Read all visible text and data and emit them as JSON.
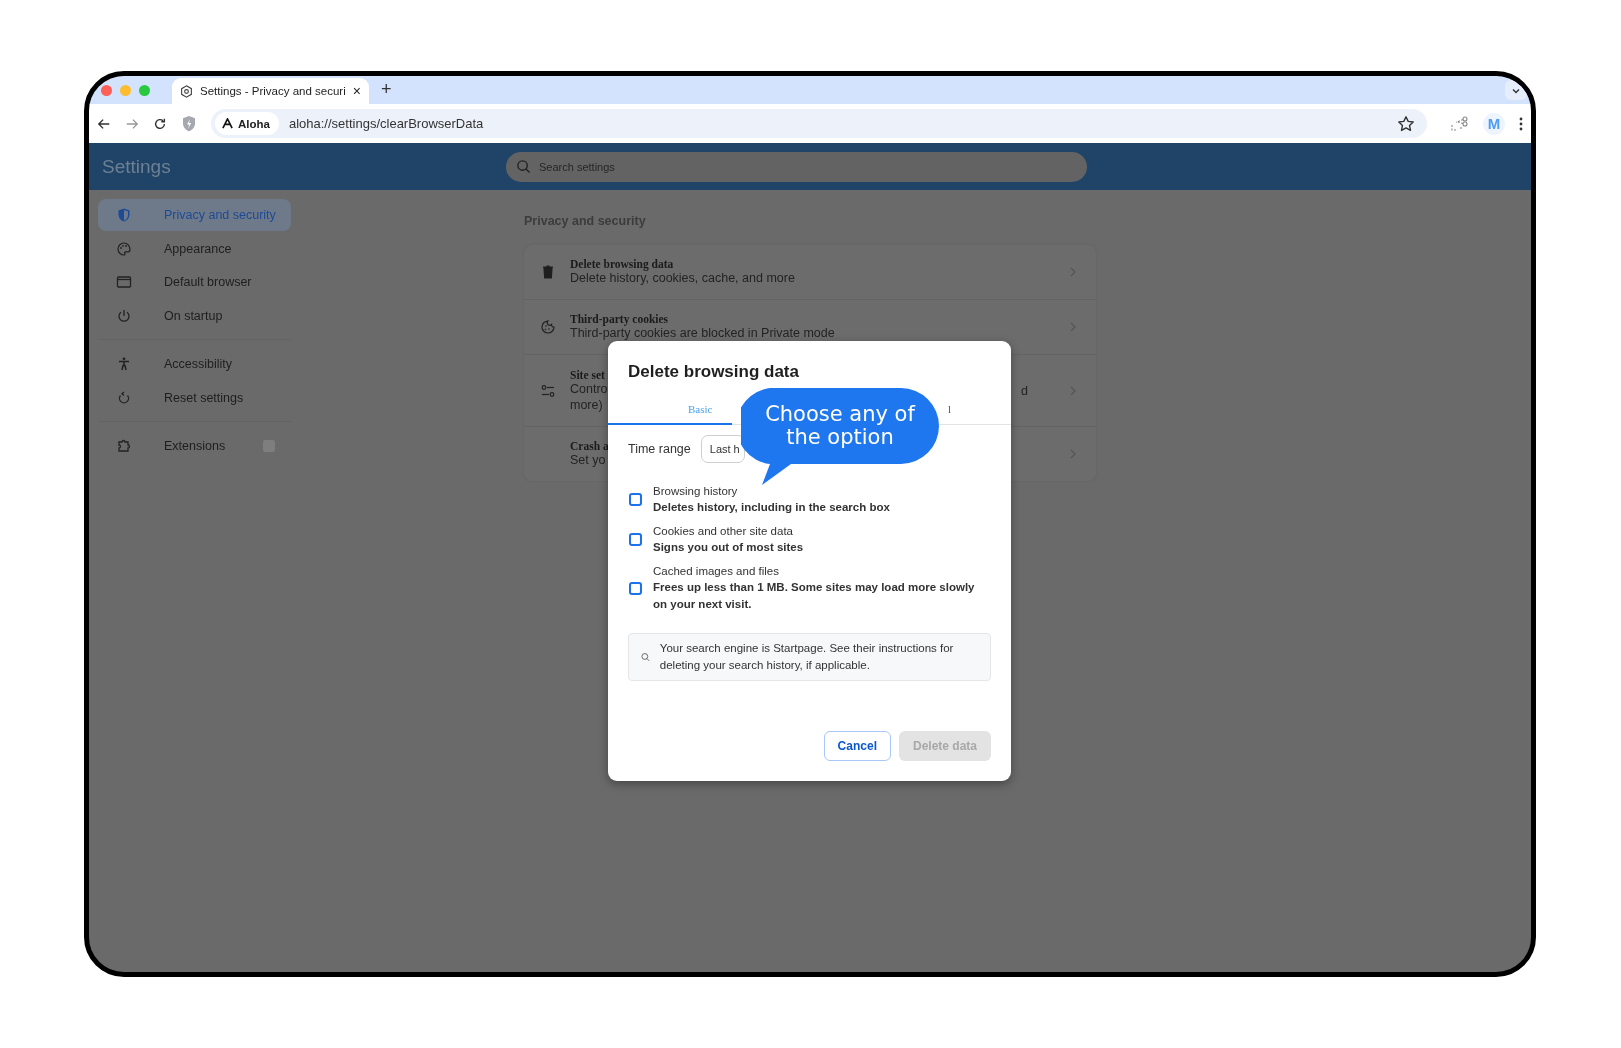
{
  "browser": {
    "tabs": [
      {
        "title": "Settings - Privacy and securi",
        "close": "×",
        "selected": true
      }
    ],
    "new_tab": "+",
    "site_chip": "Aloha",
    "url": "aloha://settings/clearBrowserData",
    "profile": "M"
  },
  "header": {
    "title": "Settings",
    "search": {
      "placeholder": "Search settings"
    }
  },
  "sidebar": {
    "groups": [
      [
        {
          "label": "Privacy and security",
          "selected": true
        },
        {
          "label": "Appearance",
          "selected": false
        },
        {
          "label": "Default browser",
          "selected": false
        },
        {
          "label": "On startup",
          "selected": false
        }
      ],
      [
        {
          "label": "Accessibility",
          "selected": false
        },
        {
          "label": "Reset settings",
          "selected": false
        }
      ],
      [
        {
          "label": "Extensions",
          "selected": false,
          "external": true
        }
      ]
    ]
  },
  "section_title": "Privacy and security",
  "rows": [
    {
      "title": "Delete browsing data",
      "lines": [
        "Delete history, cookies, cache, and more"
      ]
    },
    {
      "title": "Third-party cookies",
      "lines": [
        "Third-party cookies are blocked in Private mode"
      ]
    },
    {
      "title": "Site set",
      "lines": [
        "Contro",
        "more)"
      ],
      "tail": "d"
    },
    {
      "title": "Crash a",
      "lines": [
        "Set yo"
      ]
    }
  ],
  "dialog": {
    "title": "Delete browsing data",
    "tabs": [
      {
        "label": "Basic",
        "selected": true
      },
      {
        "label": "l",
        "selected": false
      }
    ],
    "time_range": {
      "label": "Time range",
      "value": "Last h"
    },
    "options": [
      {
        "label": "Browsing history",
        "description": [
          "Deletes history, including in the search box"
        ],
        "checked": false
      },
      {
        "label": "Cookies and other site data",
        "description": [
          "Signs you out of most sites"
        ],
        "checked": false
      },
      {
        "label": "Cached images and files",
        "description": [
          "Frees up less than 1 MB. Some sites may load more slowly",
          "on your next visit."
        ],
        "checked": false
      }
    ],
    "info": "Your search engine is Startpage. See their instructions for deleting your search history, if applicable.",
    "buttons": [
      {
        "label": "Cancel",
        "kind": "secondary",
        "disabled": false
      },
      {
        "label": "Delete data",
        "kind": "primary",
        "disabled": true
      }
    ]
  },
  "callout": {
    "lines": [
      "Choose any of",
      "the option"
    ]
  }
}
